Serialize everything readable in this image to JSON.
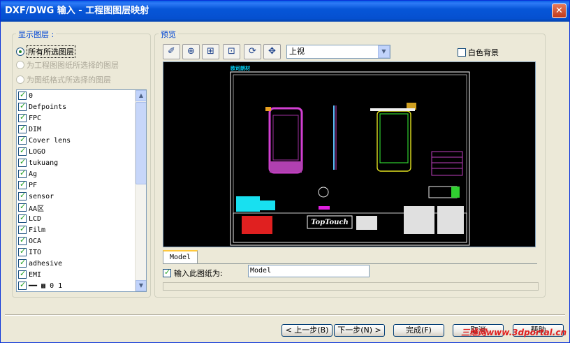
{
  "window": {
    "title": "DXF/DWG 输入 - 工程图图层映射",
    "close_glyph": "✕"
  },
  "layers_group": {
    "label": "显示图层 :",
    "options": [
      {
        "label": "所有所选图层",
        "checked": true,
        "enabled": true
      },
      {
        "label": "为工程图图纸所选择的图层",
        "checked": false,
        "enabled": false
      },
      {
        "label": "为图纸格式所选择的图层",
        "checked": false,
        "enabled": false
      }
    ],
    "layers": [
      "0",
      "Defpoints",
      "FPC",
      "DIM",
      "Cover lens",
      "LOGO",
      "tukuang",
      "Ag",
      "PF",
      "sensor",
      "AA区",
      "LCD",
      "Film",
      "OCA",
      "ITO",
      "adhesive",
      "EMI",
      "━━ ▩ 0 1"
    ]
  },
  "preview_group": {
    "label": "预览",
    "toolbar": [
      {
        "name": "select-icon",
        "glyph": "✐"
      },
      {
        "name": "zoom-in-icon",
        "glyph": "⊕"
      },
      {
        "name": "zoom-window-icon",
        "glyph": "⊞"
      },
      {
        "name": "zoom-fit-icon",
        "glyph": "⊡"
      },
      {
        "name": "rotate-icon",
        "glyph": "⟳"
      },
      {
        "name": "pan-icon",
        "glyph": "✥"
      }
    ],
    "view_combo": "上视",
    "white_background_label": "白色背景",
    "drawing": {
      "company_logo": "TopTouch",
      "header_text": "欧司朗材"
    },
    "tab_label": "Model",
    "import_as_sheet_label": "输入此图纸为:",
    "sheet_name": "Model"
  },
  "buttons": {
    "back": "< 上一步(B)",
    "next": "下一步(N) >",
    "finish": "完成(F)",
    "cancel": "取消",
    "help": "帮助"
  },
  "watermark": "三维网www.3dportal.cn",
  "colors": {
    "title_bar": "#0A5FE6",
    "window_bg": "#ECE9D8",
    "group_label": "#0046D5",
    "preview_bg": "#000000"
  }
}
